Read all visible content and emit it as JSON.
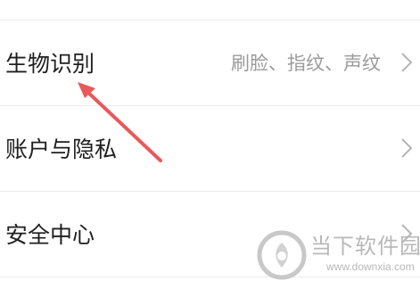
{
  "settings": {
    "items": [
      {
        "label": "生物识别",
        "value": "刷脸、指纹、声纹"
      },
      {
        "label": "账户与隐私",
        "value": ""
      },
      {
        "label": "安全中心",
        "value": ""
      }
    ]
  },
  "annotation": {
    "arrow_color": "#e8595b",
    "points_to": "生物识别"
  },
  "watermark": {
    "name": "当下软件园",
    "url": "www.downxia.com",
    "icon": "downxia-logo-icon"
  },
  "colors": {
    "label": "#1f1f1f",
    "value": "#9b9b9b",
    "chevron": "#b5b5b5",
    "divider": "#ececec"
  }
}
